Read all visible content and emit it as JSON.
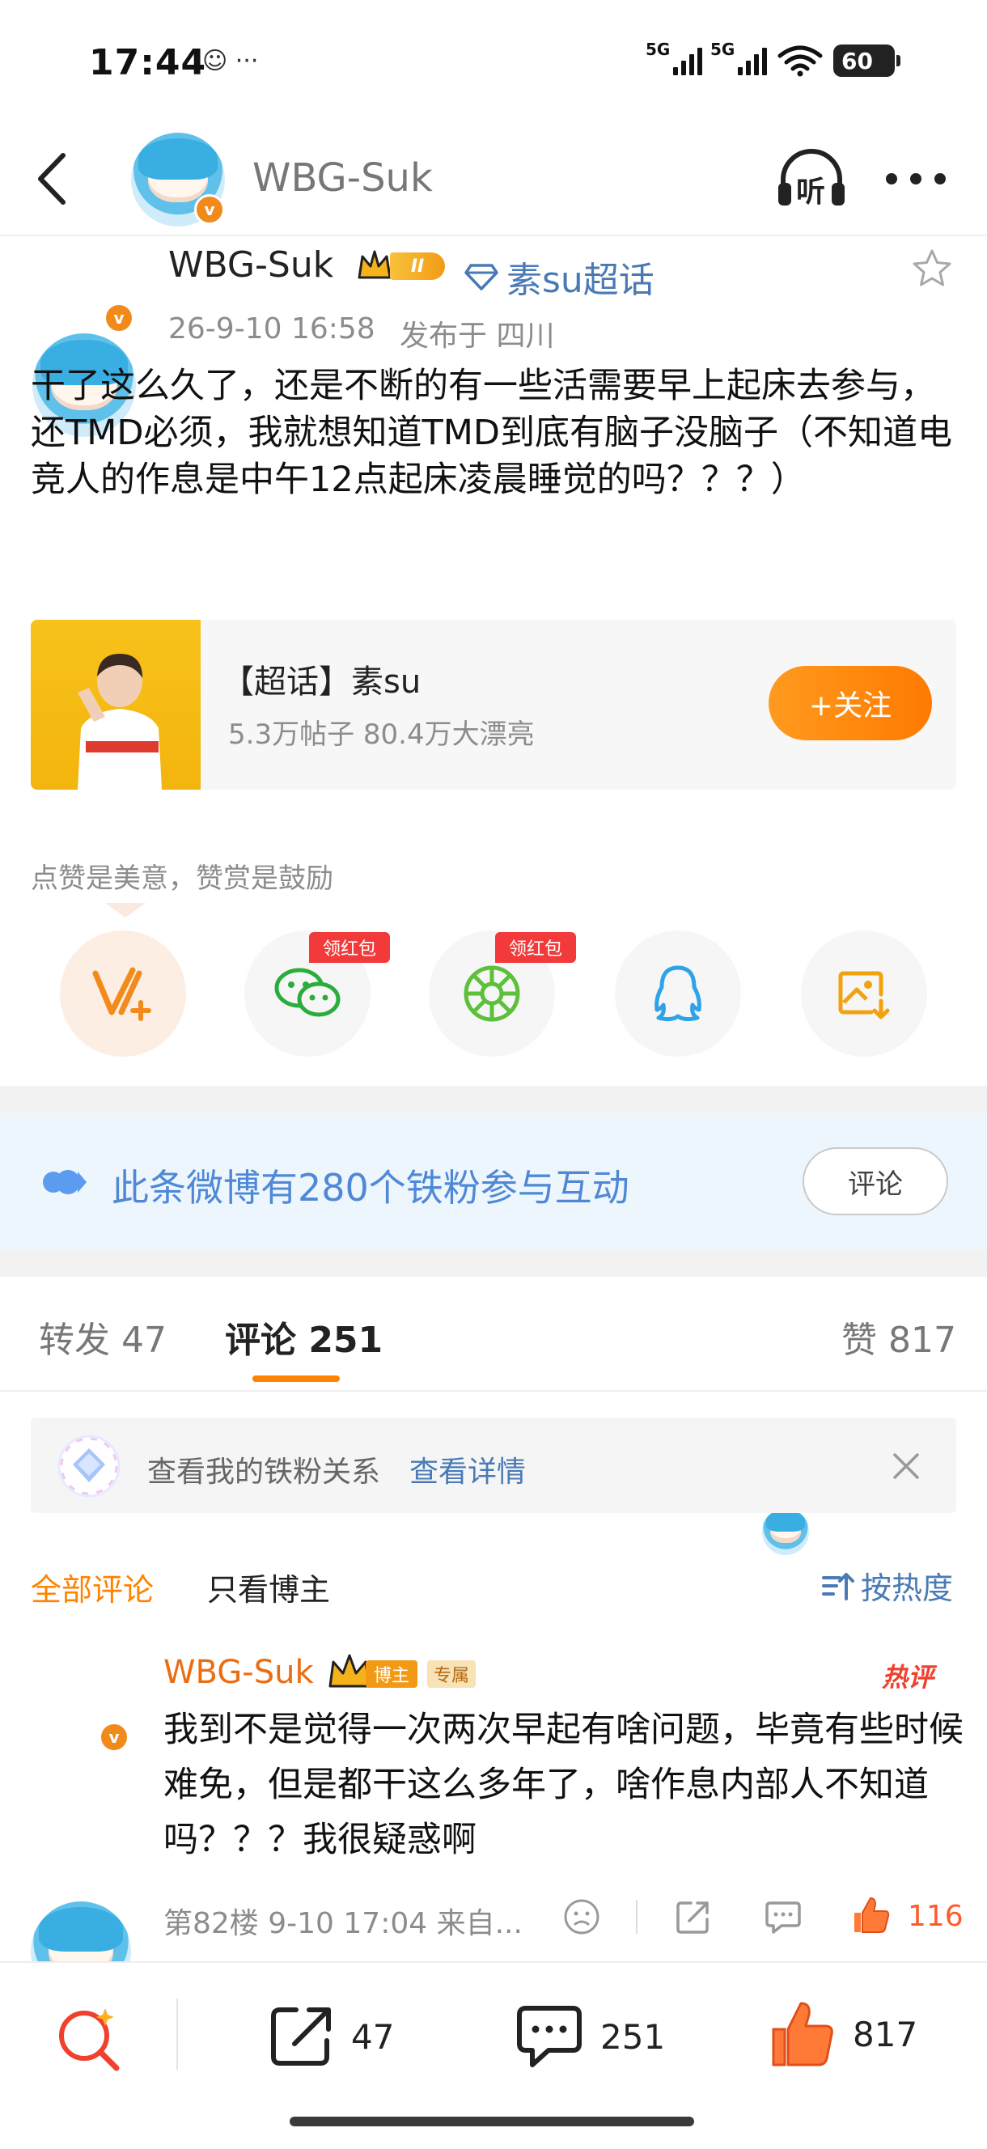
{
  "status_bar": {
    "time": "17:44",
    "extra_icons": "☺ ···",
    "network_1": "5G",
    "network_2": "5G",
    "battery": "60"
  },
  "nav": {
    "title": "WBG-Suk",
    "listen_label": "听"
  },
  "post": {
    "author": "WBG-Suk",
    "level": "II",
    "topic": "素su超话",
    "timestamp": "26-9-10 16:58",
    "location": "发布于 四川",
    "content": "干了这么久了，还是不断的有一些活需要早上起床去参与，还TMD必须，我就想知道TMD到底有脑子没脑子（不知道电竞人的作息是中午12点起床凌晨睡觉的吗？？？）"
  },
  "topic_card": {
    "title": "【超话】素su",
    "stats": "5.3万帖子 80.4万大漂亮",
    "follow_label": "+关注"
  },
  "reward": {
    "caption": "点赞是美意，赞赏是鼓励",
    "red_packet_label": "领红包"
  },
  "fans_banner": {
    "text": "此条微博有280个铁粉参与互动",
    "button": "评论"
  },
  "tabs": {
    "repost": "转发 47",
    "comment": "评论 251",
    "like": "赞 817"
  },
  "iron_fan": {
    "text": "查看我的铁粉关系",
    "link": "查看详情"
  },
  "filters": {
    "all": "全部评论",
    "owner_only": "只看博主",
    "sort": "按热度"
  },
  "comment": {
    "author": "WBG-Suk",
    "tag_owner": "博主",
    "tag_exclusive": "专属",
    "hot_label": "热评",
    "content": "我到不是觉得一次两次早起有啥问题，毕竟有些时候难免，但是都干这么多年了，啥作息内部人不知道吗？？？我很疑惑啊",
    "meta": "第82楼 9-10 17:04 来自...",
    "likes": "116"
  },
  "bottom_bar": {
    "reposts": "47",
    "comments": "251",
    "likes": "817"
  },
  "colors": {
    "accent_orange": "#ff8200",
    "link_blue": "#4a7ab5",
    "hot_red": "#f0402e"
  }
}
